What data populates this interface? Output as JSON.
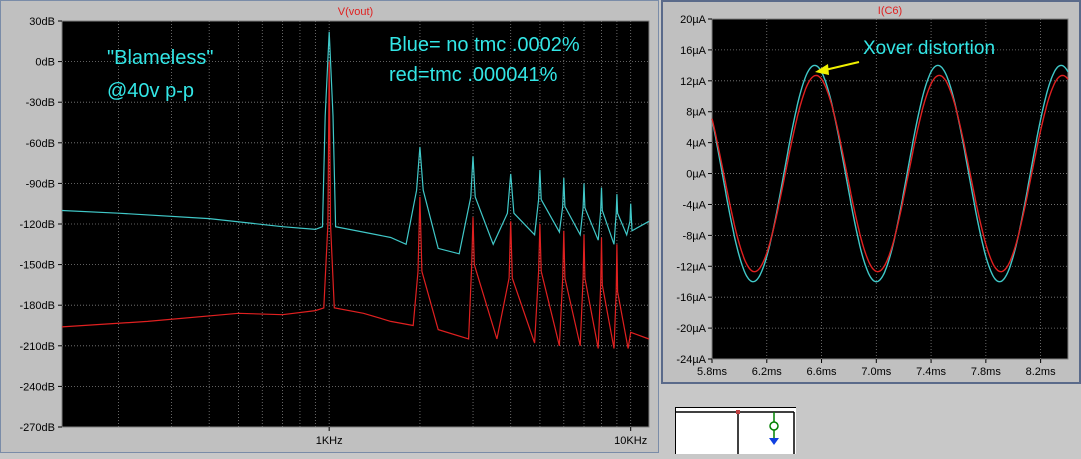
{
  "chart_data": [
    {
      "type": "line",
      "title": "V(vout)",
      "x_scale": "log",
      "xlim": [
        130,
        11500
      ],
      "x_tick_labels": [
        {
          "x": 1000,
          "label": "1KHz"
        },
        {
          "x": 10000,
          "label": "10KHz"
        }
      ],
      "ylim": [
        -270,
        30
      ],
      "y_ticks": [
        30,
        0,
        -30,
        -60,
        -90,
        -120,
        -150,
        -180,
        -210,
        -240,
        -270
      ],
      "y_tick_labels": [
        "30dB",
        "0dB",
        "-30dB",
        "-60dB",
        "-90dB",
        "-120dB",
        "-150dB",
        "-180dB",
        "-210dB",
        "-240dB",
        "-270dB"
      ],
      "background": "#000000",
      "grid": true,
      "annotations": [
        "\"Blameless\"",
        "@40v p-p",
        "Blue= no tmc .0002%",
        "red=tmc .000041%"
      ],
      "series": [
        {
          "color": "#40c8c8",
          "points": [
            [
              130,
              -110
            ],
            [
              200,
              -112
            ],
            [
              400,
              -116
            ],
            [
              700,
              -122
            ],
            [
              900,
              -124
            ],
            [
              950,
              -122
            ],
            [
              970,
              -40
            ],
            [
              1000,
              22
            ],
            [
              1030,
              -40
            ],
            [
              1050,
              -122
            ],
            [
              1300,
              -126
            ],
            [
              1600,
              -130
            ],
            [
              1800,
              -135
            ],
            [
              1950,
              -95
            ],
            [
              2000,
              -63
            ],
            [
              2050,
              -95
            ],
            [
              2300,
              -138
            ],
            [
              2700,
              -142
            ],
            [
              2950,
              -100
            ],
            [
              3000,
              -70
            ],
            [
              3050,
              -100
            ],
            [
              3500,
              -135
            ],
            [
              3900,
              -112
            ],
            [
              4000,
              -83
            ],
            [
              4100,
              -112
            ],
            [
              4800,
              -128
            ],
            [
              4950,
              -102
            ],
            [
              5000,
              -80
            ],
            [
              5050,
              -102
            ],
            [
              5800,
              -126
            ],
            [
              5950,
              -107
            ],
            [
              6000,
              -86
            ],
            [
              6050,
              -107
            ],
            [
              6800,
              -128
            ],
            [
              6950,
              -108
            ],
            [
              7000,
              -90
            ],
            [
              7050,
              -108
            ],
            [
              7800,
              -132
            ],
            [
              7950,
              -110
            ],
            [
              8000,
              -93
            ],
            [
              8050,
              -110
            ],
            [
              8800,
              -135
            ],
            [
              8950,
              -112
            ],
            [
              9000,
              -98
            ],
            [
              9050,
              -112
            ],
            [
              9700,
              -128
            ],
            [
              9950,
              -118
            ],
            [
              10000,
              -105
            ],
            [
              10100,
              -125
            ],
            [
              11500,
              -118
            ]
          ]
        },
        {
          "color": "#e02020",
          "points": [
            [
              130,
              -196
            ],
            [
              250,
              -192
            ],
            [
              500,
              -186
            ],
            [
              700,
              -187
            ],
            [
              900,
              -184
            ],
            [
              960,
              -182
            ],
            [
              990,
              -120
            ],
            [
              1000,
              0
            ],
            [
              1010,
              -120
            ],
            [
              1040,
              -182
            ],
            [
              1300,
              -186
            ],
            [
              1600,
              -192
            ],
            [
              1900,
              -195
            ],
            [
              1970,
              -155
            ],
            [
              2000,
              -100
            ],
            [
              2030,
              -155
            ],
            [
              2300,
              -198
            ],
            [
              2900,
              -205
            ],
            [
              2970,
              -150
            ],
            [
              3000,
              -115
            ],
            [
              3030,
              -150
            ],
            [
              3600,
              -205
            ],
            [
              3950,
              -160
            ],
            [
              4000,
              -118
            ],
            [
              4050,
              -160
            ],
            [
              4800,
              -208
            ],
            [
              4950,
              -155
            ],
            [
              5000,
              -120
            ],
            [
              5050,
              -155
            ],
            [
              5800,
              -210
            ],
            [
              5950,
              -160
            ],
            [
              6000,
              -125
            ],
            [
              6050,
              -160
            ],
            [
              6800,
              -210
            ],
            [
              6950,
              -160
            ],
            [
              7000,
              -128
            ],
            [
              7050,
              -160
            ],
            [
              7800,
              -212
            ],
            [
              7950,
              -165
            ],
            [
              8000,
              -130
            ],
            [
              8050,
              -165
            ],
            [
              8800,
              -212
            ],
            [
              8950,
              -170
            ],
            [
              9000,
              -135
            ],
            [
              9050,
              -170
            ],
            [
              9800,
              -212
            ],
            [
              10000,
              -200
            ],
            [
              11500,
              -205
            ]
          ]
        }
      ]
    },
    {
      "type": "line",
      "title": "I(C6)",
      "xlim": [
        5.8,
        8.4
      ],
      "x_ticks": [
        5.8,
        6.2,
        6.6,
        7.0,
        7.4,
        7.8,
        8.2
      ],
      "x_tick_labels": [
        "5.8ms",
        "6.2ms",
        "6.6ms",
        "7.0ms",
        "7.4ms",
        "7.8ms",
        "8.2ms"
      ],
      "ylim": [
        -24,
        20
      ],
      "y_ticks": [
        20,
        16,
        12,
        8,
        4,
        0,
        -4,
        -8,
        -12,
        -16,
        -20,
        -24
      ],
      "y_tick_labels": [
        "20µA",
        "16µA",
        "12µA",
        "8µA",
        "4µA",
        "0µA",
        "-4µA",
        "-8µA",
        "-12µA",
        "-16µA",
        "-20µA",
        "-24µA"
      ],
      "background": "#000000",
      "grid": true,
      "annotations": [
        "Xover distortion"
      ],
      "series": [
        {
          "color": "#40c8c8",
          "period_ms": 0.9,
          "peak_time_ms": 6.55,
          "amplitude": 14.0,
          "offset": 0
        },
        {
          "color": "#e02020",
          "period_ms": 0.9,
          "peak_time_ms": 6.56,
          "amplitude": 12.7,
          "offset": 0
        }
      ]
    }
  ],
  "colors": {
    "title_red": "#e02020",
    "annotation_cyan": "#33e6e6",
    "arrow_yellow": "#f0f000",
    "grid": "#808080"
  }
}
